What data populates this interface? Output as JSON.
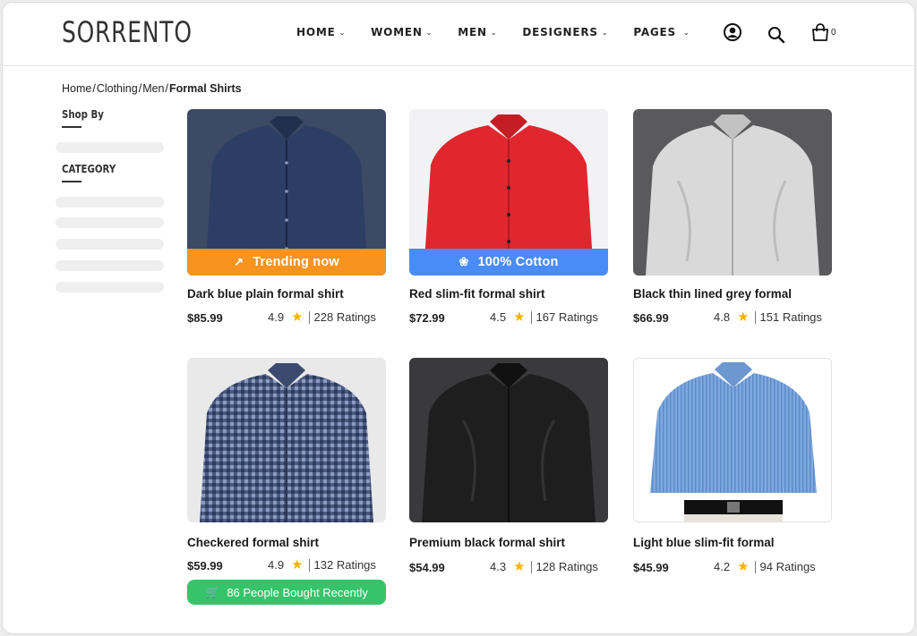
{
  "brand": {
    "logo_text": "SORRENTO"
  },
  "nav": {
    "items": [
      {
        "label": "HOME"
      },
      {
        "label": "WOMEN"
      },
      {
        "label": "MEN"
      },
      {
        "label": "DESIGNERS"
      },
      {
        "label": "PAGES"
      }
    ],
    "cart_count": "0",
    "icons": [
      "user-icon",
      "search-icon",
      "cart-icon"
    ]
  },
  "breadcrumb": {
    "items": [
      "Home",
      "Clothing",
      "Men"
    ],
    "separator": "/",
    "current": "Formal Shirts"
  },
  "sidebar": {
    "shop_by_title": "Shop By",
    "category_title": "CATEGORY"
  },
  "products": [
    {
      "name": "Dark blue plain formal shirt",
      "price": "$85.99",
      "rating": "4.9",
      "ratings_count": "228 Ratings",
      "badge": "Trending now",
      "badge_color": "#f7931e",
      "shirt_color": "#2c3e63"
    },
    {
      "name": "Red slim-fit formal shirt",
      "price": "$72.99",
      "rating": "4.5",
      "ratings_count": "167 Ratings",
      "badge": "100% Cotton",
      "badge_color": "#4a8cf7",
      "shirt_color": "#e0262e"
    },
    {
      "name": "Black thin lined grey formal",
      "price": "$66.99",
      "rating": "4.8",
      "ratings_count": "151 Ratings",
      "shirt_color": "#d9d9d9"
    },
    {
      "name": "Checkered formal shirt",
      "price": "$59.99",
      "rating": "4.9",
      "ratings_count": "132 Ratings",
      "shirt_color": "#4a5a80"
    },
    {
      "name": "Premium black formal shirt",
      "price": "$54.99",
      "rating": "4.3",
      "ratings_count": "128 Ratings",
      "shirt_color": "#1e1e1e"
    },
    {
      "name": "Light blue slim-fit formal",
      "price": "$45.99",
      "rating": "4.2",
      "ratings_count": "94 Ratings",
      "shirt_color": "#7fa9dd"
    }
  ],
  "social_proof": {
    "text": "86 People Bought Recently",
    "color": "#35c46a"
  },
  "colors": {
    "star": "#f5b301",
    "text": "#1a1a1a"
  }
}
